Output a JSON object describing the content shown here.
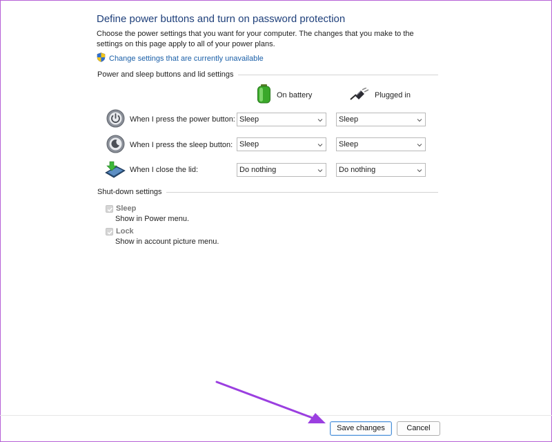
{
  "page": {
    "title": "Define power buttons and turn on password protection",
    "description": "Choose the power settings that you want for your computer. The changes that you make to the settings on this page apply to all of your power plans.",
    "change_link": "Change settings that are currently unavailable",
    "change_link_icon": "uac-shield-icon"
  },
  "buttons_section": {
    "label": "Power and sleep buttons and lid settings",
    "columns": {
      "battery": "On battery",
      "plugged": "Plugged in"
    },
    "rows": [
      {
        "label": "When I press the power button:",
        "icon": "power-button-icon",
        "battery": "Sleep",
        "plugged": "Sleep"
      },
      {
        "label": "When I press the sleep button:",
        "icon": "sleep-button-icon",
        "battery": "Sleep",
        "plugged": "Sleep"
      },
      {
        "label": "When I close the lid:",
        "icon": "laptop-lid-icon",
        "battery": "Do nothing",
        "plugged": "Do nothing"
      }
    ]
  },
  "shutdown_section": {
    "label": "Shut-down settings",
    "items": [
      {
        "title": "Sleep",
        "subtitle": "Show in Power menu.",
        "checked": true,
        "enabled": false
      },
      {
        "title": "Lock",
        "subtitle": "Show in account picture menu.",
        "checked": true,
        "enabled": false
      }
    ]
  },
  "footer": {
    "save_label": "Save changes",
    "cancel_label": "Cancel"
  },
  "colors": {
    "title": "#1e3f7a",
    "link": "#1a5fa8",
    "annotation_arrow": "#9b3fe0",
    "frame_border": "#b65fd6"
  }
}
